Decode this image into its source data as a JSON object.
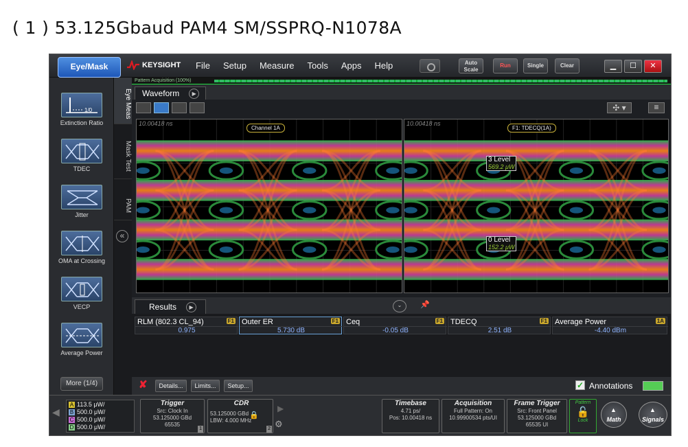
{
  "caption": "( 1 ) 53.125Gbaud PAM4 SM/SSPRQ-N1078A",
  "topbar": {
    "mode_button": "Eye/Mask",
    "brand": "KEYSIGHT",
    "menu": [
      "File",
      "Setup",
      "Measure",
      "Tools",
      "Apps",
      "Help"
    ],
    "auto_scale": "Auto Scale",
    "run": "Run",
    "single": "Single",
    "clear": "Clear"
  },
  "left_panel": {
    "items": [
      "Extinction Ratio",
      "TDEC",
      "Jitter",
      "OMA at Crossing",
      "VECP",
      "Average Power"
    ],
    "more": "More (1/4)",
    "tabs": [
      "Eye Meas",
      "Mask Test",
      "PAM"
    ]
  },
  "acquisition_bar": "Pattern Acquisition  (100%)",
  "waveform_tab": "Waveform",
  "plots": [
    {
      "timestamp": "10.00418 ns",
      "label": "Channel 1A"
    },
    {
      "timestamp": "10.00418 ns",
      "label": "F1: TDECQ(1A)",
      "level3_name": "3 Level",
      "level3_value": "569.2 μW",
      "level0_name": "0 Level",
      "level0_value": "152.2 μW"
    }
  ],
  "results": {
    "tab": "Results",
    "measurements": [
      {
        "name": "RLM (802.3 CL_94)",
        "tag": "F1",
        "value": "0.975"
      },
      {
        "name": "Outer ER",
        "tag": "F1",
        "value": "5.730 dB"
      },
      {
        "name": "Ceq",
        "tag": "F1",
        "value": "-0.05 dB"
      },
      {
        "name": "TDECQ",
        "tag": "F1",
        "value": "2.51 dB"
      },
      {
        "name": "Average Power",
        "tag": "1A",
        "value": "-4.40 dBm"
      }
    ],
    "details": "Details...",
    "limits": "Limits...",
    "setup": "Setup...",
    "annotations": "Annotations"
  },
  "status": {
    "channels": [
      {
        "id": "A",
        "value": "113.5 μW/",
        "color": "#d9c230"
      },
      {
        "id": "B",
        "value": "500.0 μW/",
        "color": "#7fa7d6"
      },
      {
        "id": "C",
        "value": "500.0 μW/",
        "color": "#c86bd4"
      },
      {
        "id": "D",
        "value": "500.0 μW/",
        "color": "#8ad08a"
      }
    ],
    "trigger": {
      "title": "Trigger",
      "line1": "Src: Clock In",
      "line2": "53.125000 GBd",
      "line3": "65535",
      "num": "1"
    },
    "cdr": {
      "title": "CDR",
      "line1": "53.125000 GBd",
      "line2": "LBW: 4.000 MHz",
      "num": "2"
    },
    "timebase": {
      "title": "Timebase",
      "line1": "4.71 ps/",
      "line2": "Pos: 10.00418 ns"
    },
    "acquisition": {
      "title": "Acquisition",
      "line1": "Full Pattern: On",
      "line2": "10.99900534 pts/UI"
    },
    "frame_trigger": {
      "title": "Frame Trigger",
      "line1": "Src: Front Panel",
      "line2": "53.125000 GBd",
      "line3": "65535 UI"
    },
    "pattern": {
      "title": "Pattern",
      "sub": "Lock"
    },
    "math": "Math",
    "signals": "Signals"
  }
}
